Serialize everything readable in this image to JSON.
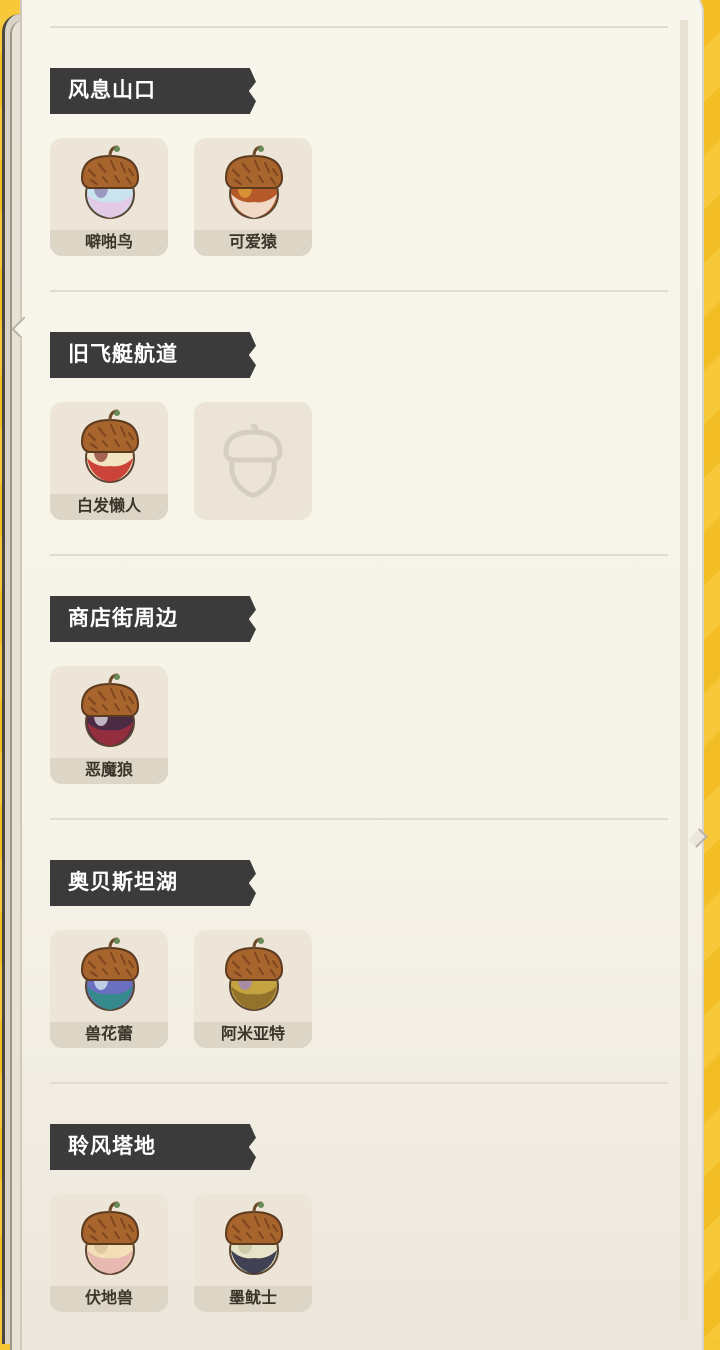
{
  "regions": [
    {
      "title": "风息山口",
      "items": [
        {
          "name": "噼啪鸟",
          "colors": [
            "#c9e4ef",
            "#e6c7e3",
            "#8e7fb0"
          ],
          "found": true
        },
        {
          "name": "可爱猿",
          "colors": [
            "#b75a2a",
            "#f6e7d6",
            "#e3a33a"
          ],
          "found": true
        }
      ]
    },
    {
      "title": "旧飞艇航道",
      "items": [
        {
          "name": "白发懒人",
          "colors": [
            "#f3e4c2",
            "#c8322a",
            "#8b3a2b"
          ],
          "found": true
        },
        {
          "name": "",
          "found": false,
          "icon": "acorn-silhouette-icon"
        }
      ]
    },
    {
      "title": "商店街周边",
      "items": [
        {
          "name": "恶魔狼",
          "colors": [
            "#4b2a44",
            "#9b2f3e",
            "#e9e4ee"
          ],
          "found": true
        }
      ]
    },
    {
      "title": "奥贝斯坦湖",
      "items": [
        {
          "name": "兽花蕾",
          "colors": [
            "#6a6fc0",
            "#2f8d86",
            "#d9eef2"
          ],
          "found": true
        },
        {
          "name": "阿米亚特",
          "colors": [
            "#c4a340",
            "#8e6d2a",
            "#9d86c6"
          ],
          "found": true
        }
      ]
    },
    {
      "title": "聆风塔地",
      "items": [
        {
          "name": "伏地兽",
          "colors": [
            "#f2dfb8",
            "#e7b5b0",
            "#d9c19a"
          ],
          "found": true
        },
        {
          "name": "墨鱿士",
          "colors": [
            "#e7e3c8",
            "#2e2f45",
            "#c6c19e"
          ],
          "found": true
        }
      ]
    }
  ]
}
